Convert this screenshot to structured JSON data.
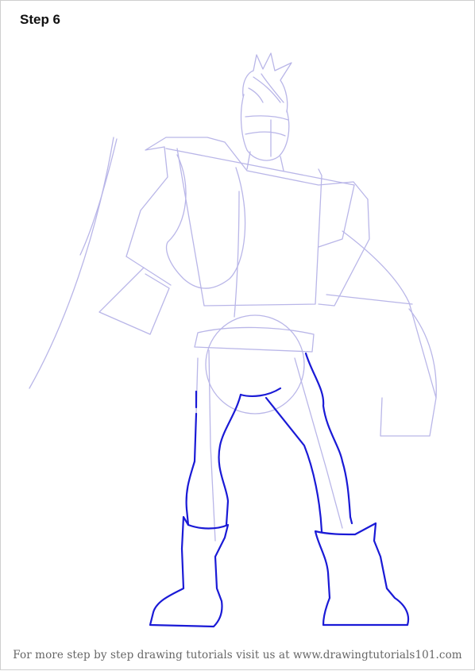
{
  "step": {
    "title": "Step 6"
  },
  "footer": {
    "text": "For more step by step drawing tutorials visit us at www.drawingtutorials101.com"
  },
  "colors": {
    "guide_lines": "#b9b6e8",
    "current_step_lines": "#1a1ad6",
    "background": "#ffffff"
  }
}
